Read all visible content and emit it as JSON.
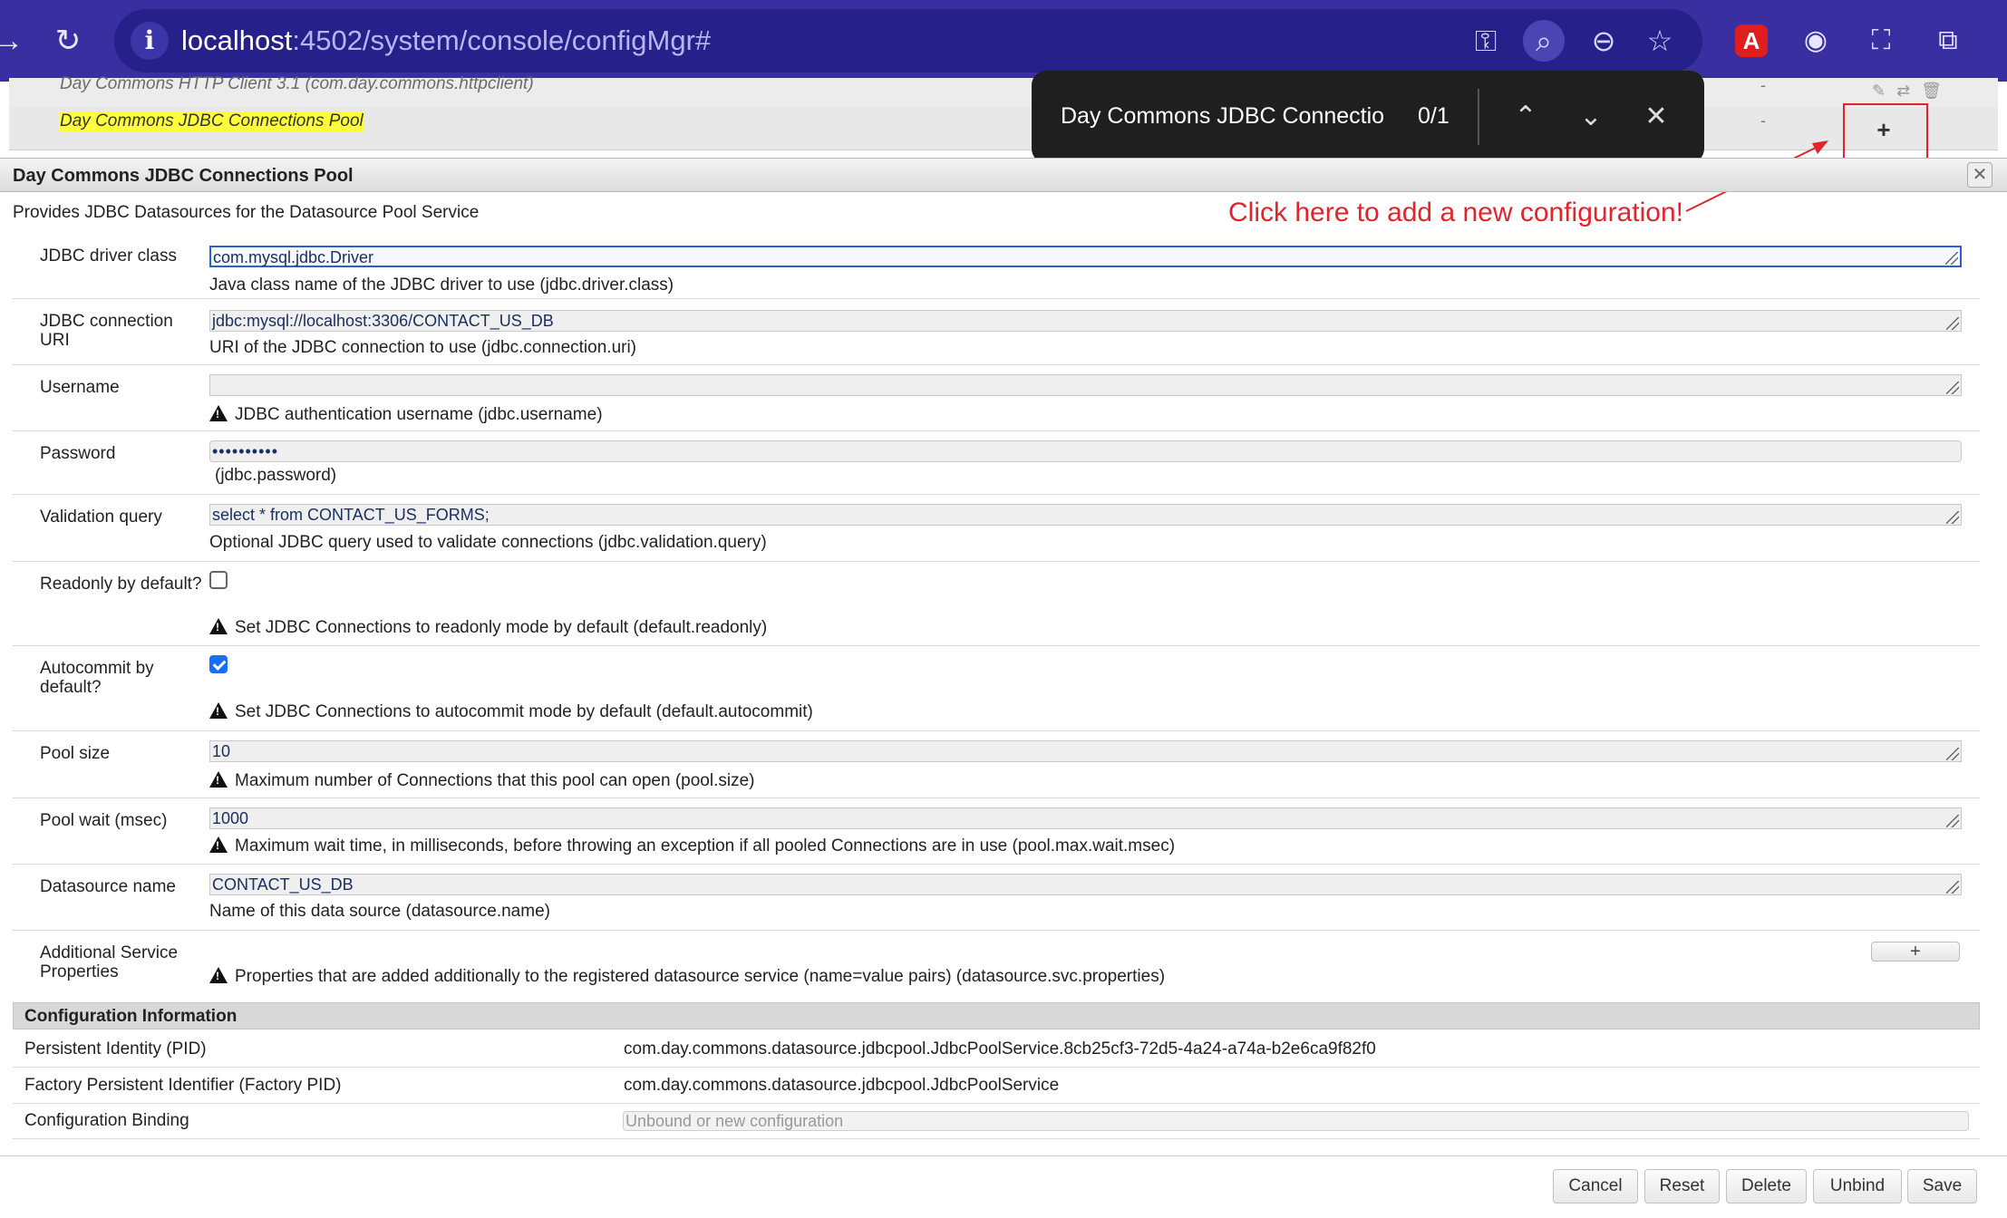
{
  "browser": {
    "url_host": "localhost",
    "url_path": ":4502/system/console/configMgr#"
  },
  "component_list": {
    "rows": [
      {
        "name": "Day Commons HTTP Client 3.1",
        "pid": "(com.day.commons.httpclient)",
        "status": "-"
      },
      {
        "name": "Day Commons JDBC Connections Pool",
        "status": "-"
      }
    ]
  },
  "find_bar": {
    "query": "Day Commons JDBC Connectio",
    "count": "0/1"
  },
  "annotation": {
    "text": "Click here to add a new configuration!",
    "color": "#e3242b"
  },
  "dialog": {
    "title": "Day Commons JDBC Connections Pool",
    "description": "Provides JDBC Datasources for the Datasource Pool Service",
    "fields": {
      "driver": {
        "label": "JDBC driver class",
        "value": "com.mysql.jdbc.Driver",
        "help": "Java class name of the JDBC driver to use (jdbc.driver.class)"
      },
      "uri": {
        "label": "JDBC connection URI",
        "value": "jdbc:mysql://localhost:3306/CONTACT_US_DB",
        "help": "URI of the JDBC connection to use (jdbc.connection.uri)"
      },
      "username": {
        "label": "Username",
        "value": "",
        "help": "JDBC authentication username (jdbc.username)"
      },
      "password": {
        "label": "Password",
        "value": "••••••••••",
        "help": "(jdbc.password)"
      },
      "validation": {
        "label": "Validation query",
        "value": "select * from CONTACT_US_FORMS;",
        "help": "Optional JDBC query used to validate connections (jdbc.validation.query)"
      },
      "readonly": {
        "label": "Readonly by default?",
        "checked": false,
        "help": "Set JDBC Connections to readonly mode by default (default.readonly)"
      },
      "autocommit": {
        "label": "Autocommit by default?",
        "checked": true,
        "help": "Set JDBC Connections to autocommit mode by default (default.autocommit)"
      },
      "pool_size": {
        "label": "Pool size",
        "value": "10",
        "help": "Maximum number of Connections that this pool can open (pool.size)"
      },
      "pool_wait": {
        "label": "Pool wait (msec)",
        "value": "1000",
        "help": "Maximum wait time, in milliseconds, before throwing an exception if all pooled Connections are in use (pool.max.wait.msec)"
      },
      "datasource": {
        "label": "Datasource name",
        "value": "CONTACT_US_DB",
        "help": "Name of this data source (datasource.name)"
      },
      "additional": {
        "label": "Additional Service Properties",
        "add_label": "+",
        "help": "Properties that are added additionally to the registered datasource service (name=value pairs) (datasource.svc.properties)"
      }
    },
    "config_info": {
      "heading": "Configuration Information",
      "pid_label": "Persistent Identity (PID)",
      "pid_value": "com.day.commons.datasource.jdbcpool.JdbcPoolService.8cb25cf3-72d5-4a24-a74a-b2e6ca9f82f0",
      "factory_label": "Factory Persistent Identifier (Factory PID)",
      "factory_value": "com.day.commons.datasource.jdbcpool.JdbcPoolService",
      "binding_label": "Configuration Binding",
      "binding_value": "Unbound or new configuration"
    },
    "buttons": {
      "cancel": "Cancel",
      "reset": "Reset",
      "delete": "Delete",
      "unbind": "Unbind",
      "save": "Save"
    }
  }
}
